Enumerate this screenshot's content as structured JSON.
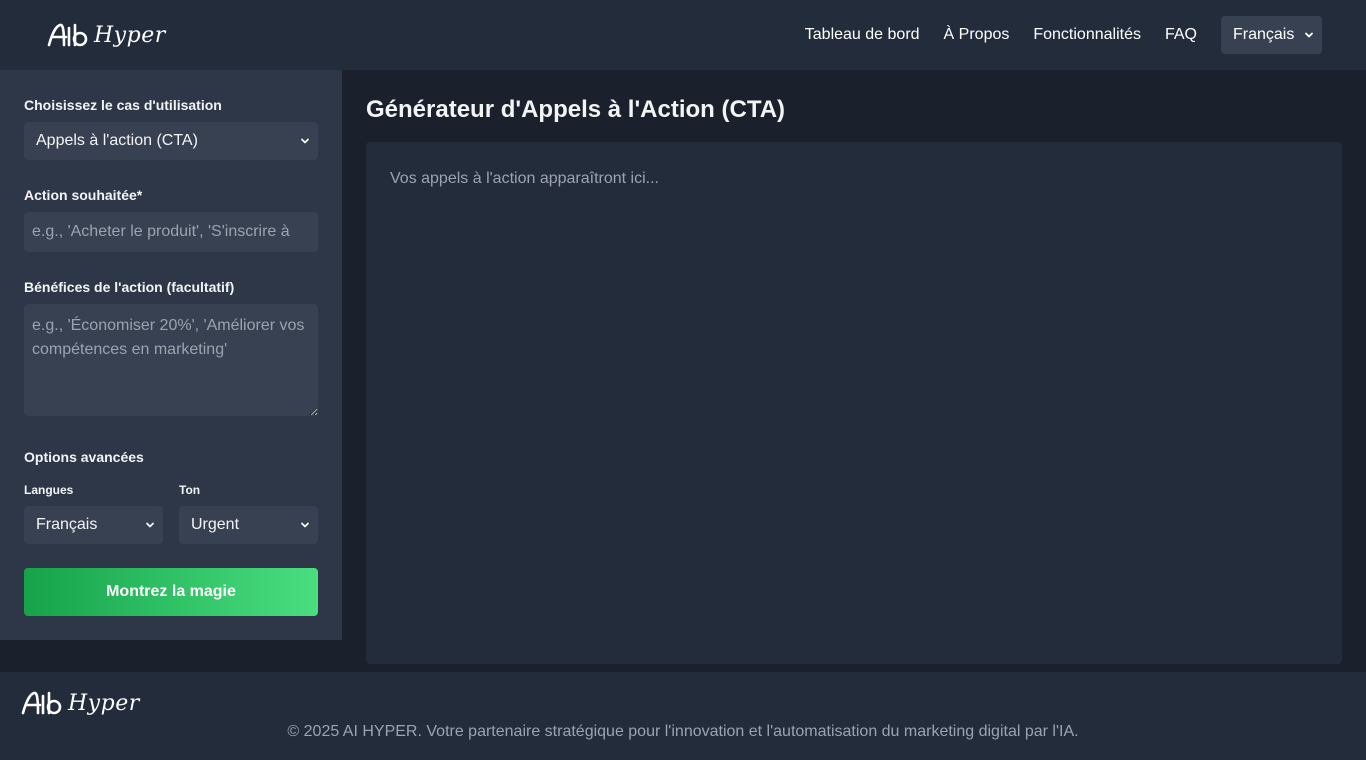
{
  "brand": {
    "logo_text": "Hyper"
  },
  "nav": {
    "items": [
      {
        "label": "Tableau de bord"
      },
      {
        "label": "À Propos"
      },
      {
        "label": "Fonctionnalités"
      },
      {
        "label": "FAQ"
      }
    ],
    "language": "Français"
  },
  "sidebar": {
    "use_case_label": "Choisissez le cas d'utilisation",
    "use_case_value": "Appels à l'action (CTA)",
    "action_label": "Action souhaitée*",
    "action_placeholder": "e.g., 'Acheter le produit', 'S'inscrire à",
    "benefits_label": "Bénéfices de l'action (facultatif)",
    "benefits_placeholder": "e.g., 'Économiser 20%', 'Améliorer vos compétences en marketing'",
    "advanced_label": "Options avancées",
    "languages_label": "Langues",
    "languages_value": "Français",
    "tone_label": "Ton",
    "tone_value": "Urgent",
    "submit_label": "Montrez la magie"
  },
  "main": {
    "title": "Générateur d'Appels à l'Action (CTA)",
    "output_placeholder": "Vos appels à l'action apparaîtront ici..."
  },
  "footer": {
    "logo_text": "Hyper",
    "copyright": "© 2025 AI HYPER. Votre partenaire stratégique pour l'innovation et l'automatisation du marketing digital par l'IA."
  },
  "colors": {
    "header_bg": "#232c3b",
    "sidebar_bg": "#2d3748",
    "page_bg": "#1a202c",
    "field_bg": "#374151",
    "accent_start": "#16a34a",
    "accent_end": "#4ade80"
  }
}
